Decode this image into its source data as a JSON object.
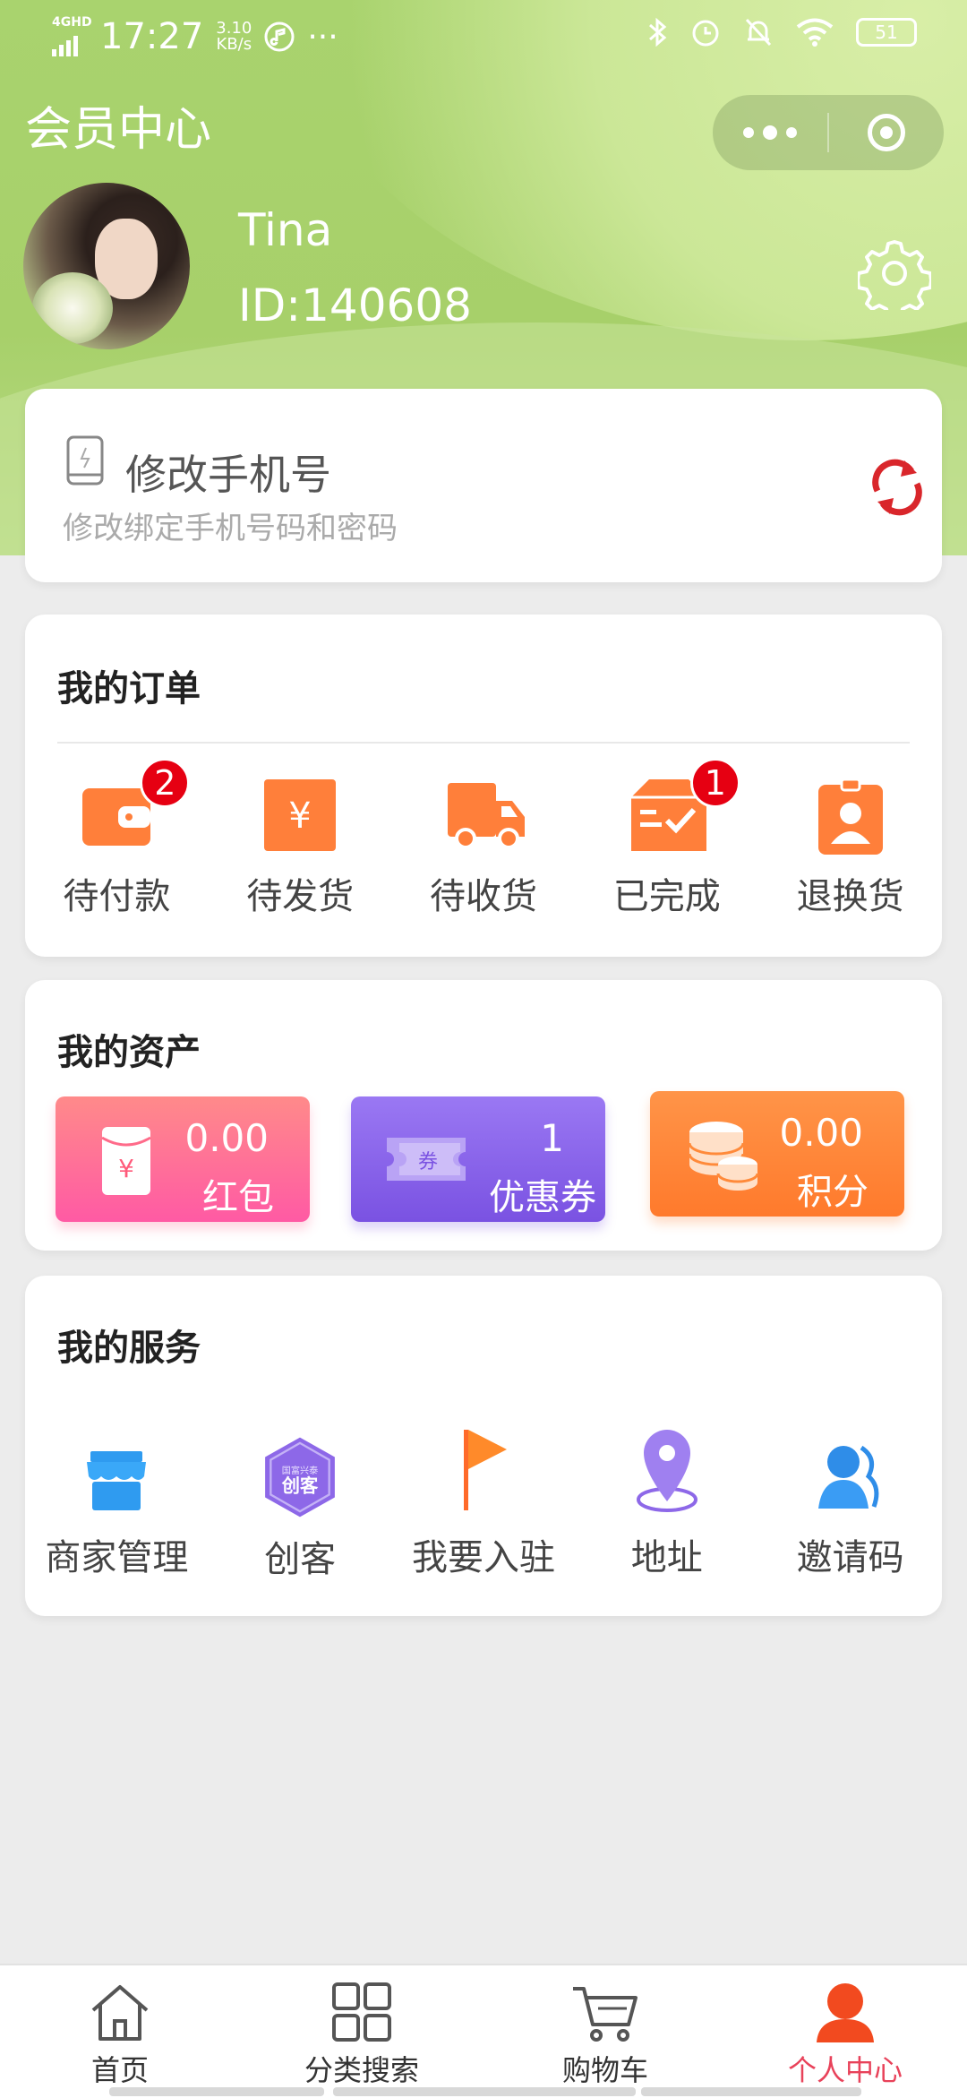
{
  "status_bar": {
    "network": "4GHD",
    "time": "17:27",
    "speed_value": "3.10",
    "speed_unit": "KB/s",
    "more": "···",
    "battery": "51"
  },
  "header": {
    "title": "会员中心",
    "user_name": "Tina",
    "user_id": "ID:140608"
  },
  "phone_card": {
    "title": "修改手机号",
    "subtitle": "修改绑定手机号码和密码"
  },
  "orders": {
    "title": "我的订单",
    "items": [
      {
        "label": "待付款",
        "badge": "2",
        "icon": "wallet-icon"
      },
      {
        "label": "待发货",
        "badge": "",
        "icon": "yen-box-icon"
      },
      {
        "label": "待收货",
        "badge": "",
        "icon": "truck-icon"
      },
      {
        "label": "已完成",
        "badge": "1",
        "icon": "completed-box-icon"
      },
      {
        "label": "退换货",
        "badge": "",
        "icon": "id-badge-icon"
      }
    ]
  },
  "assets": {
    "title": "我的资产",
    "items": [
      {
        "value": "0.00",
        "label": "红包",
        "icon": "red-envelope-icon",
        "color": "#ff6b9a"
      },
      {
        "value": "1",
        "label": "优惠券",
        "coupon_text": "券",
        "icon": "coupon-icon",
        "color": "#8a62ea"
      },
      {
        "value": "0.00",
        "label": "积分",
        "icon": "coins-icon",
        "color": "#ff8a3a"
      }
    ]
  },
  "services": {
    "title": "我的服务",
    "items": [
      {
        "label": "商家管理",
        "icon": "store-icon"
      },
      {
        "label": "创客",
        "icon": "maker-badge-icon",
        "badge_small": "国富兴泰",
        "badge_big": "创客"
      },
      {
        "label": "我要入驻",
        "icon": "flag-icon"
      },
      {
        "label": "地址",
        "icon": "location-pin-icon"
      },
      {
        "label": "邀请码",
        "icon": "invite-user-icon"
      }
    ]
  },
  "tabbar": {
    "items": [
      {
        "label": "首页",
        "icon": "home-icon"
      },
      {
        "label": "分类搜索",
        "icon": "grid-icon"
      },
      {
        "label": "购物车",
        "icon": "cart-icon"
      },
      {
        "label": "个人中心",
        "icon": "person-icon",
        "active": true
      }
    ],
    "active_color": "#e8425a"
  }
}
